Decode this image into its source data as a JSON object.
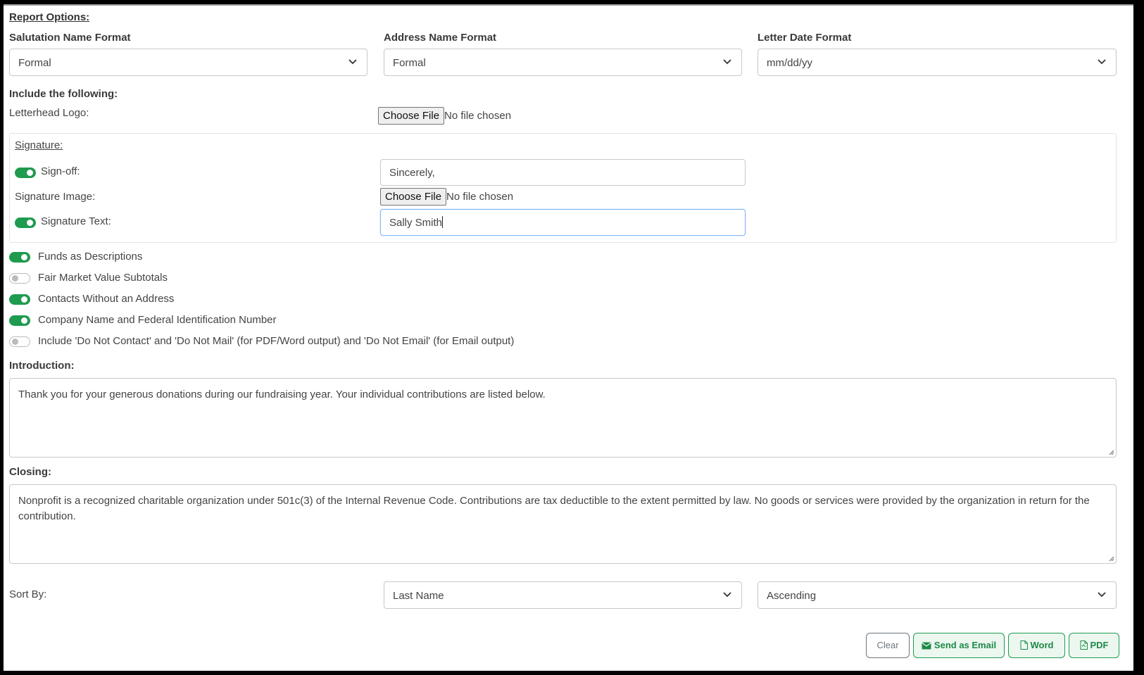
{
  "report_options": {
    "title": "Report Options:",
    "salutation": {
      "label": "Salutation Name Format",
      "value": "Formal"
    },
    "address": {
      "label": "Address Name Format",
      "value": "Formal"
    },
    "letter_date": {
      "label": "Letter Date Format",
      "value": "mm/dd/yy"
    }
  },
  "include": {
    "heading": "Include the following:",
    "letterhead_label": "Letterhead Logo:",
    "file_button": "Choose File",
    "file_status": "No file chosen"
  },
  "signature": {
    "title": "Signature:",
    "signoff_label": "Sign-off:",
    "signoff_value": "Sincerely,",
    "signoff_enabled": true,
    "image_label": "Signature Image:",
    "file_button": "Choose File",
    "file_status": "No file chosen",
    "text_label": "Signature Text:",
    "text_value": "Sally Smith",
    "text_enabled": true
  },
  "toggles": [
    {
      "label": "Funds as Descriptions",
      "on": true
    },
    {
      "label": "Fair Market Value Subtotals",
      "on": false
    },
    {
      "label": "Contacts Without an Address",
      "on": true
    },
    {
      "label": "Company Name and Federal Identification Number",
      "on": true
    },
    {
      "label": "Include 'Do Not Contact' and 'Do Not Mail' (for PDF/Word output) and 'Do Not Email' (for Email output)",
      "on": false
    }
  ],
  "introduction": {
    "label": "Introduction:",
    "value": "Thank you for your generous donations during our fundraising year.  Your individual contributions are listed below."
  },
  "closing": {
    "label": "Closing:",
    "value": "Nonprofit is a recognized charitable organization under 501c(3) of the Internal Revenue Code.  Contributions are tax deductible to the extent permitted by law.  No goods or services were provided by the organization in return for the contribution."
  },
  "sort": {
    "label": "Sort By:",
    "field": "Last Name",
    "direction": "Ascending"
  },
  "actions": {
    "clear": "Clear",
    "email": "Send as Email",
    "word": "Word",
    "pdf": "PDF"
  },
  "colors": {
    "accent_green": "#1e9b4f",
    "border": "#c8c8c8"
  }
}
